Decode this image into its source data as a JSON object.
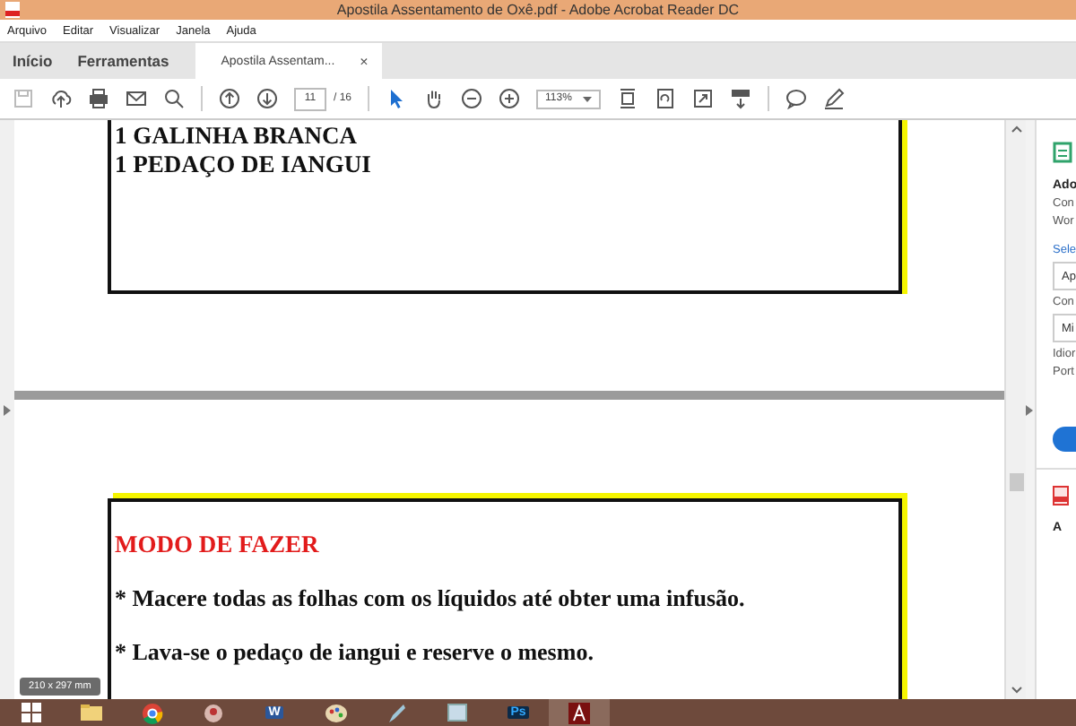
{
  "window": {
    "title": "Apostila  Assentamento de Oxê.pdf - Adobe Acrobat Reader DC"
  },
  "menu": [
    "Arquivo",
    "Editar",
    "Visualizar",
    "Janela",
    "Ajuda"
  ],
  "tabs": [
    {
      "label": "Início",
      "kind": "home",
      "selected": false
    },
    {
      "label": "Ferramentas",
      "kind": "home",
      "selected": false
    },
    {
      "label": "Apostila  Assentam...",
      "kind": "document",
      "selected": true,
      "close": "×"
    }
  ],
  "toolbar": {
    "page": "11",
    "page_total": "/ 16",
    "zoom": "113%"
  },
  "pages": [
    {
      "lines": [
        {
          "kind": "item",
          "text": "1 GALINHA BRANCA"
        },
        {
          "kind": "item",
          "text": "1 PEDAÇO DE IANGUI"
        }
      ]
    },
    {
      "lines": [
        {
          "kind": "heading",
          "text": "MODO DE FAZER"
        },
        {
          "kind": "step",
          "text": "* Macere todas as folhas com os líquidos até obter uma infusão."
        },
        {
          "kind": "step",
          "text": "* Lava-se o pedaço de iangui e reserve o mesmo."
        }
      ]
    }
  ],
  "page_size": "210 x 297 mm",
  "right_panel": [
    {
      "kind": "icon"
    },
    {
      "kind": "title",
      "text": "Ado"
    },
    {
      "kind": "text",
      "text": "Con"
    },
    {
      "kind": "text",
      "text": "Wor"
    },
    {
      "kind": "link",
      "text": "Sele"
    },
    {
      "kind": "field",
      "text": "Ap"
    },
    {
      "kind": "text",
      "text": "Con"
    },
    {
      "kind": "field",
      "text": "Mi"
    },
    {
      "kind": "text",
      "text": "Idior"
    },
    {
      "kind": "text",
      "text": "Port"
    },
    {
      "kind": "button"
    },
    {
      "kind": "divider"
    },
    {
      "kind": "pdf-icon"
    },
    {
      "kind": "title",
      "text": "A"
    }
  ],
  "taskbar": [
    {
      "kind": "folder"
    },
    {
      "kind": "browser"
    },
    {
      "kind": "tool"
    },
    {
      "kind": "word",
      "label": "W"
    },
    {
      "kind": "paint"
    },
    {
      "kind": "pen"
    },
    {
      "kind": "window"
    },
    {
      "kind": "ps",
      "label": "Ps"
    },
    {
      "kind": "acrobat",
      "selected": true
    }
  ]
}
